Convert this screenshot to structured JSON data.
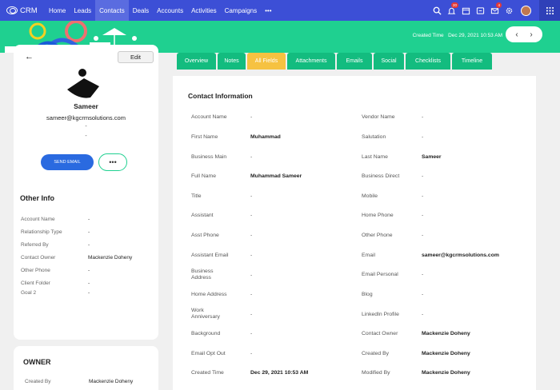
{
  "app": {
    "name": "CRM"
  },
  "nav": {
    "links": [
      {
        "label": "Home"
      },
      {
        "label": "Leads"
      },
      {
        "label": "Contacts"
      },
      {
        "label": "Deals"
      },
      {
        "label": "Accounts"
      },
      {
        "label": "Activities"
      },
      {
        "label": "Campaigns"
      },
      {
        "label": "•••"
      }
    ],
    "active": "Contacts",
    "badges": {
      "notifications": "20",
      "mail": "4"
    }
  },
  "banner": {
    "created_label": "Created Time",
    "created_value": "Dec 29, 2021 10:53 AM",
    "prev_icon": "chevron-left-icon",
    "next_icon": "chevron-right-icon"
  },
  "profile": {
    "back": "←",
    "edit_label": "Edit",
    "name": "Sameer",
    "email": "sameer@kgcrmsolutions.com",
    "line1": "-",
    "line2": "-",
    "send_email_label": "SEND EMAIL",
    "more_label": "•••"
  },
  "other_info": {
    "title": "Other Info",
    "rows": [
      {
        "label": "Account Name",
        "value": "-"
      },
      {
        "label": "Relationship Type",
        "value": "-"
      },
      {
        "label": "Referred By",
        "value": "-"
      },
      {
        "label": "Contact Owner",
        "value": "Mackenzie Doheny"
      },
      {
        "label": "Other Phone",
        "value": "-"
      },
      {
        "label": "Client Folder",
        "value": "-"
      },
      {
        "label": "Goal 2",
        "value": "-"
      }
    ]
  },
  "owner": {
    "title": "OWNER",
    "created_by_label": "Created By",
    "created_by_value": "Mackenzie Doheny"
  },
  "tabs": [
    {
      "label": "Overview"
    },
    {
      "label": "Notes"
    },
    {
      "label": "All Fields"
    },
    {
      "label": "Attachments"
    },
    {
      "label": "Emails"
    },
    {
      "label": "Social"
    },
    {
      "label": "Checklists"
    },
    {
      "label": "Timeline"
    }
  ],
  "active_tab": "All Fields",
  "contact_info": {
    "title": "Contact Information",
    "left": [
      {
        "label": "Account Name",
        "value": "-"
      },
      {
        "label": "First Name",
        "value": "Muhammad"
      },
      {
        "label": "Business Main",
        "value": "-"
      },
      {
        "label": "Full Name",
        "value": "Muhammad Sameer"
      },
      {
        "label": "Title",
        "value": "-"
      },
      {
        "label": "Assistant",
        "value": "-"
      },
      {
        "label": "Asst Phone",
        "value": "-"
      },
      {
        "label": "Assistant Email",
        "value": "-"
      },
      {
        "label": "Business Address",
        "value": "-"
      },
      {
        "label": "Home Address",
        "value": "-"
      },
      {
        "label": "Work Anniversary",
        "value": "-"
      },
      {
        "label": "Background",
        "value": "-"
      },
      {
        "label": "Email Opt Out",
        "value": "-"
      },
      {
        "label": "Created Time",
        "value": "Dec 29, 2021 10:53 AM"
      }
    ],
    "right": [
      {
        "label": "Vendor Name",
        "value": "-"
      },
      {
        "label": "Salutation",
        "value": "-"
      },
      {
        "label": "Last Name",
        "value": "Sameer"
      },
      {
        "label": "Business Direct",
        "value": "-"
      },
      {
        "label": "Mobile",
        "value": "-"
      },
      {
        "label": "Home Phone",
        "value": "-"
      },
      {
        "label": "Other Phone",
        "value": "-"
      },
      {
        "label": "Email",
        "value": "sameer@kgcrmsolutions.com"
      },
      {
        "label": "Email Personal",
        "value": "-"
      },
      {
        "label": "Blog",
        "value": "-"
      },
      {
        "label": "LinkedIn Profile",
        "value": "-"
      },
      {
        "label": "Contact Owner",
        "value": "Mackenzie Doheny"
      },
      {
        "label": "Created By",
        "value": "Mackenzie Doheny"
      },
      {
        "label": "Modified By",
        "value": "Mackenzie Doheny"
      }
    ]
  },
  "colors": {
    "nav": "#3c4fd6",
    "banner": "#1fd090",
    "tab": "#13bc7f",
    "tab_active": "#f6c241",
    "primary_button": "#2a6ae0"
  }
}
